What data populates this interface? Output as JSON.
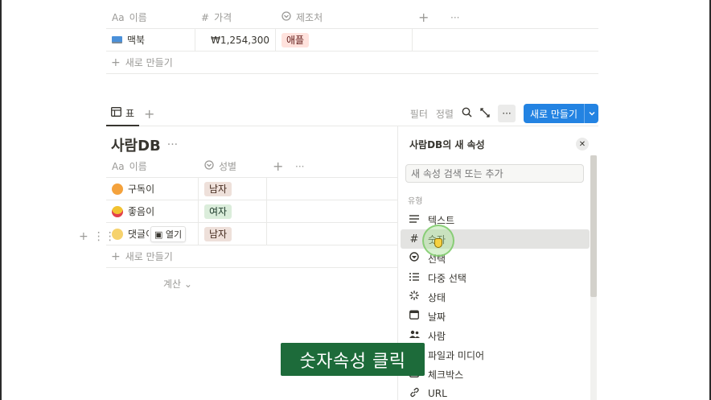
{
  "top_table": {
    "columns": [
      {
        "icon": "Aa",
        "label": "이름"
      },
      {
        "icon": "#",
        "label": "가격"
      },
      {
        "icon": "select-icon",
        "label": "제조처"
      }
    ],
    "row": {
      "emoji": "laptop",
      "name": "맥북",
      "price": "₩1,254,300",
      "maker": "애플"
    },
    "add_row": "새로 만들기"
  },
  "toolbar": {
    "tab_label": "표",
    "filter": "필터",
    "sort": "정렬",
    "new_button": "새로 만들기"
  },
  "people_db": {
    "title": "사람DB",
    "columns": [
      {
        "icon": "Aa",
        "label": "이름"
      },
      {
        "icon": "select-icon",
        "label": "성별"
      }
    ],
    "rows": [
      {
        "name": "구독이",
        "gender": "남자"
      },
      {
        "name": "좋음이",
        "gender": "여자"
      },
      {
        "name": "댓글이",
        "gender": "남자"
      }
    ],
    "open_label": "열기",
    "add_row": "새로 만들기",
    "calc": "계산"
  },
  "panel": {
    "title": "사람DB의 새 속성",
    "search_placeholder": "새 속성 검색 또는 추가",
    "section": "유형",
    "types": [
      {
        "icon": "text-icon",
        "label": "텍스트"
      },
      {
        "icon": "number-icon",
        "label": "숫자"
      },
      {
        "icon": "select-icon",
        "label": "선택"
      },
      {
        "icon": "multi-select-icon",
        "label": "다중 선택"
      },
      {
        "icon": "status-icon",
        "label": "상태"
      },
      {
        "icon": "date-icon",
        "label": "날짜"
      },
      {
        "icon": "person-icon",
        "label": "사람"
      },
      {
        "icon": "file-icon",
        "label": "파일과 미디어"
      },
      {
        "icon": "checkbox-icon",
        "label": "체크박스"
      },
      {
        "icon": "url-icon",
        "label": "URL"
      }
    ]
  },
  "caption": "숫자속성 클릭",
  "colors": {
    "accent": "#2383e2",
    "tag_red": "#ffe2dd",
    "tag_brown": "#eee0da",
    "tag_green": "#dbeddb",
    "caption_bg": "#1d6b3a"
  }
}
